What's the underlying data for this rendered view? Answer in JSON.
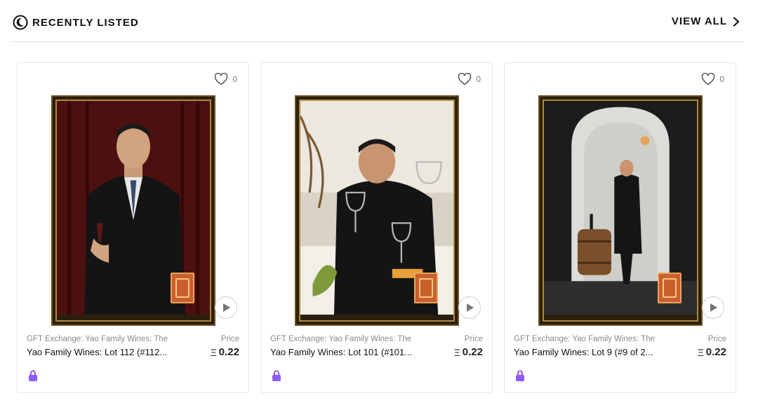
{
  "header": {
    "title": "RECENTLY LISTED",
    "view_all": "VIEW ALL"
  },
  "colors": {
    "lock": "#8b5cf6",
    "frame_gold": "#b08a3a"
  },
  "icons": {
    "section": "dark-mode-icon",
    "view_all": "chevron-right-icon",
    "like": "heart-icon",
    "play": "play-icon",
    "lock": "lock-icon"
  },
  "cards": [
    {
      "likes": "0",
      "collection": "GFT Exchange: Yao Family Wines: The C",
      "name": "Yao Family Wines: Lot 112 (#112...",
      "price_label": "Price",
      "price": "0.22",
      "currency": "Ξ"
    },
    {
      "likes": "0",
      "collection": "GFT Exchange: Yao Family Wines: The C",
      "name": "Yao Family Wines: Lot 101 (#101...",
      "price_label": "Price",
      "price": "0.22",
      "currency": "Ξ"
    },
    {
      "likes": "0",
      "collection": "GFT Exchange: Yao Family Wines: The C",
      "name": "Yao Family Wines: Lot 9 (#9 of 2...",
      "price_label": "Price",
      "price": "0.22",
      "currency": "Ξ"
    }
  ]
}
